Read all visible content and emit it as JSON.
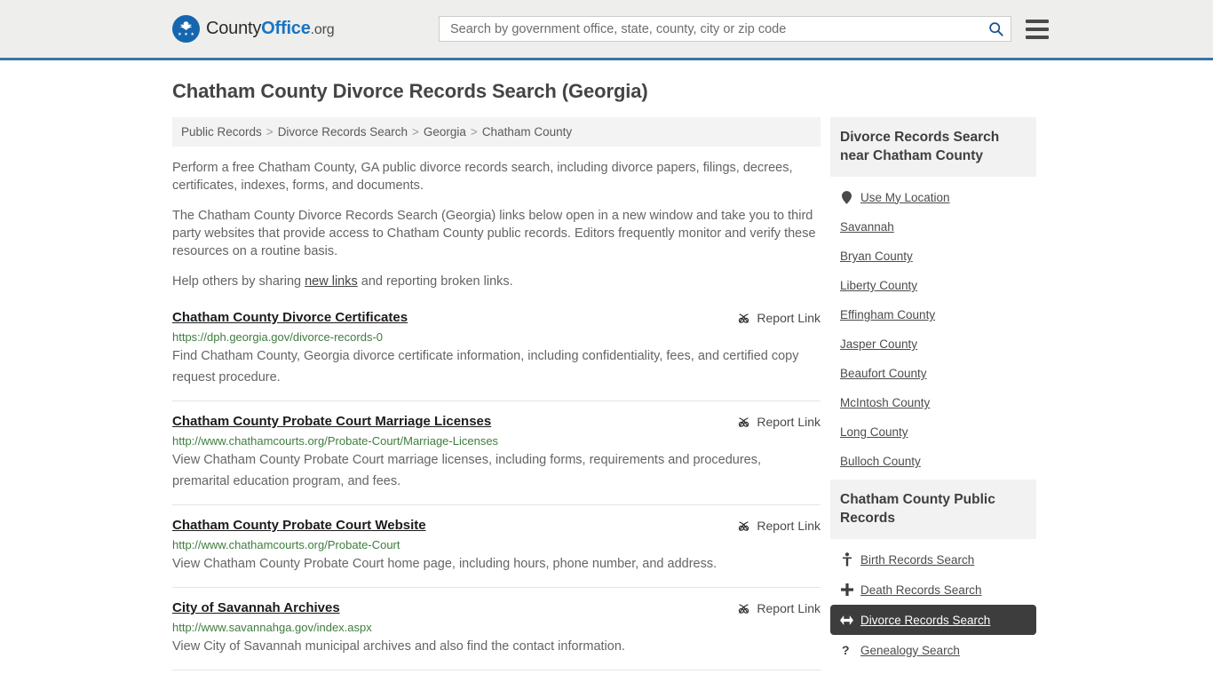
{
  "header": {
    "logo": {
      "icon": "eagle-shield-logo",
      "text_county": "County",
      "text_office": "Office",
      "text_org": ".org"
    },
    "search": {
      "placeholder": "Search by government office, state, county, city or zip code",
      "value": "",
      "search_icon": "search-icon"
    },
    "menu_icon": "hamburger-menu-icon"
  },
  "page": {
    "title": "Chatham County Divorce Records Search (Georgia)"
  },
  "breadcrumb": {
    "separator": ">",
    "items": [
      {
        "label": "Public Records"
      },
      {
        "label": "Divorce Records Search"
      },
      {
        "label": "Georgia"
      },
      {
        "label": "Chatham County"
      }
    ]
  },
  "intro": {
    "p1": "Perform a free Chatham County, GA public divorce records search, including divorce papers, filings, decrees, certificates, indexes, forms, and documents.",
    "p2": "The Chatham County Divorce Records Search (Georgia) links below open in a new window and take you to third party websites that provide access to Chatham County public records. Editors frequently monitor and verify these resources on a routine basis.",
    "p3_before": "Help others by sharing ",
    "p3_link": "new links",
    "p3_after": " and reporting broken links."
  },
  "results": {
    "report_label": "Report Link",
    "report_icon": "broken-link-icon",
    "items": [
      {
        "title": "Chatham County Divorce Certificates",
        "url": "https://dph.georgia.gov/divorce-records-0",
        "description": "Find Chatham County, Georgia divorce certificate information, including confidentiality, fees, and certified copy request procedure."
      },
      {
        "title": "Chatham County Probate Court Marriage Licenses",
        "url": "http://www.chathamcourts.org/Probate-Court/Marriage-Licenses",
        "description": "View Chatham County Probate Court marriage licenses, including forms, requirements and procedures, premarital education program, and fees."
      },
      {
        "title": "Chatham County Probate Court Website",
        "url": "http://www.chathamcourts.org/Probate-Court",
        "description": "View Chatham County Probate Court home page, including hours, phone number, and address."
      },
      {
        "title": "City of Savannah Archives",
        "url": "http://www.savannahga.gov/index.aspx",
        "description": "View City of Savannah municipal archives and also find the contact information."
      }
    ]
  },
  "sidebar": {
    "nearby": {
      "heading": "Divorce Records Search near Chatham County",
      "items": [
        {
          "label": "Use My Location",
          "icon": "map-pin-icon"
        },
        {
          "label": "Savannah",
          "icon": ""
        },
        {
          "label": "Bryan County",
          "icon": ""
        },
        {
          "label": "Liberty County",
          "icon": ""
        },
        {
          "label": "Effingham County",
          "icon": ""
        },
        {
          "label": "Jasper County",
          "icon": ""
        },
        {
          "label": "Beaufort County",
          "icon": ""
        },
        {
          "label": "McIntosh County",
          "icon": ""
        },
        {
          "label": "Long County",
          "icon": ""
        },
        {
          "label": "Bulloch County",
          "icon": ""
        }
      ]
    },
    "public_records": {
      "heading": "Chatham County Public Records",
      "items": [
        {
          "label": "Birth Records Search",
          "icon": "baby-icon",
          "active": false
        },
        {
          "label": "Death Records Search",
          "icon": "cross-icon",
          "active": false
        },
        {
          "label": "Divorce Records Search",
          "icon": "split-arrow-icon",
          "active": true
        },
        {
          "label": "Genealogy Search",
          "icon": "question-icon",
          "active": false
        }
      ]
    }
  },
  "colors": {
    "header_bg": "#eeeeec",
    "header_border": "#3b74a8",
    "brand_blue": "#1a73c4",
    "url_green": "#3f7d3f",
    "panel_bg": "#f2f2f2",
    "active_bg": "#3d3d3d"
  }
}
